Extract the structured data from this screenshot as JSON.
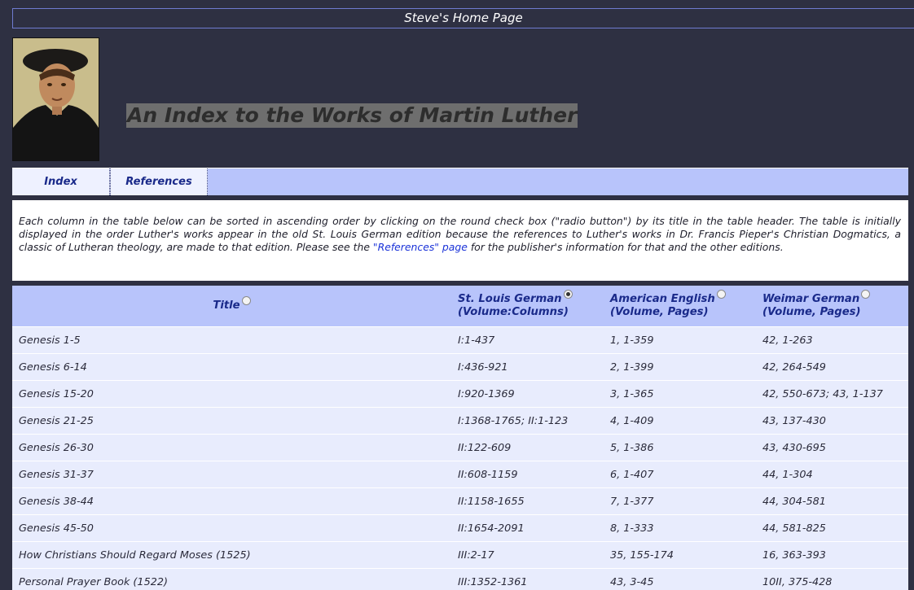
{
  "header": {
    "site_title": "Steve's Home Page",
    "page_title": "An Index to the Works of Martin Luther"
  },
  "nav": {
    "tabs": [
      {
        "label": "Index"
      },
      {
        "label": "References"
      }
    ]
  },
  "intro": {
    "text_before_link": "Each column in the table below can be sorted in ascending order by clicking on the round check box (\"radio button\") by its title in the table header. The table is initially displayed in the order Luther's works appear in the old St. Louis German edition because the references to Luther's works in Dr. Francis Pieper's Christian Dogmatics, a classic of Lutheran theology, are made to that edition. Please see the",
    "link_text": "\"References\" page",
    "text_after_link": "for the publisher's information for that and the other editions."
  },
  "table": {
    "columns": [
      {
        "line1": "Title",
        "line2": "",
        "sorted": false
      },
      {
        "line1": "St. Louis German",
        "line2": "(Volume:Columns)",
        "sorted": true
      },
      {
        "line1": "American English",
        "line2": "(Volume, Pages)",
        "sorted": false
      },
      {
        "line1": "Weimar German",
        "line2": "(Volume, Pages)",
        "sorted": false
      }
    ],
    "rows": [
      [
        "Genesis 1-5",
        "I:1-437",
        "1, 1-359",
        "42, 1-263"
      ],
      [
        "Genesis 6-14",
        "I:436-921",
        "2, 1-399",
        "42, 264-549"
      ],
      [
        "Genesis 15-20",
        "I:920-1369",
        "3, 1-365",
        "42, 550-673; 43, 1-137"
      ],
      [
        "Genesis 21-25",
        "I:1368-1765; II:1-123",
        "4, 1-409",
        "43, 137-430"
      ],
      [
        "Genesis 26-30",
        "II:122-609",
        "5, 1-386",
        "43, 430-695"
      ],
      [
        "Genesis 31-37",
        "II:608-1159",
        "6, 1-407",
        "44, 1-304"
      ],
      [
        "Genesis 38-44",
        "II:1158-1655",
        "7, 1-377",
        "44, 304-581"
      ],
      [
        "Genesis 45-50",
        "II:1654-2091",
        "8, 1-333",
        "44, 581-825"
      ],
      [
        "How Christians Should Regard Moses (1525)",
        "III:2-17",
        "35, 155-174",
        "16, 363-393"
      ],
      [
        "Personal Prayer Book (1522)",
        "III:1352-1361",
        "43, 3-45",
        "10II, 375-428"
      ]
    ]
  }
}
